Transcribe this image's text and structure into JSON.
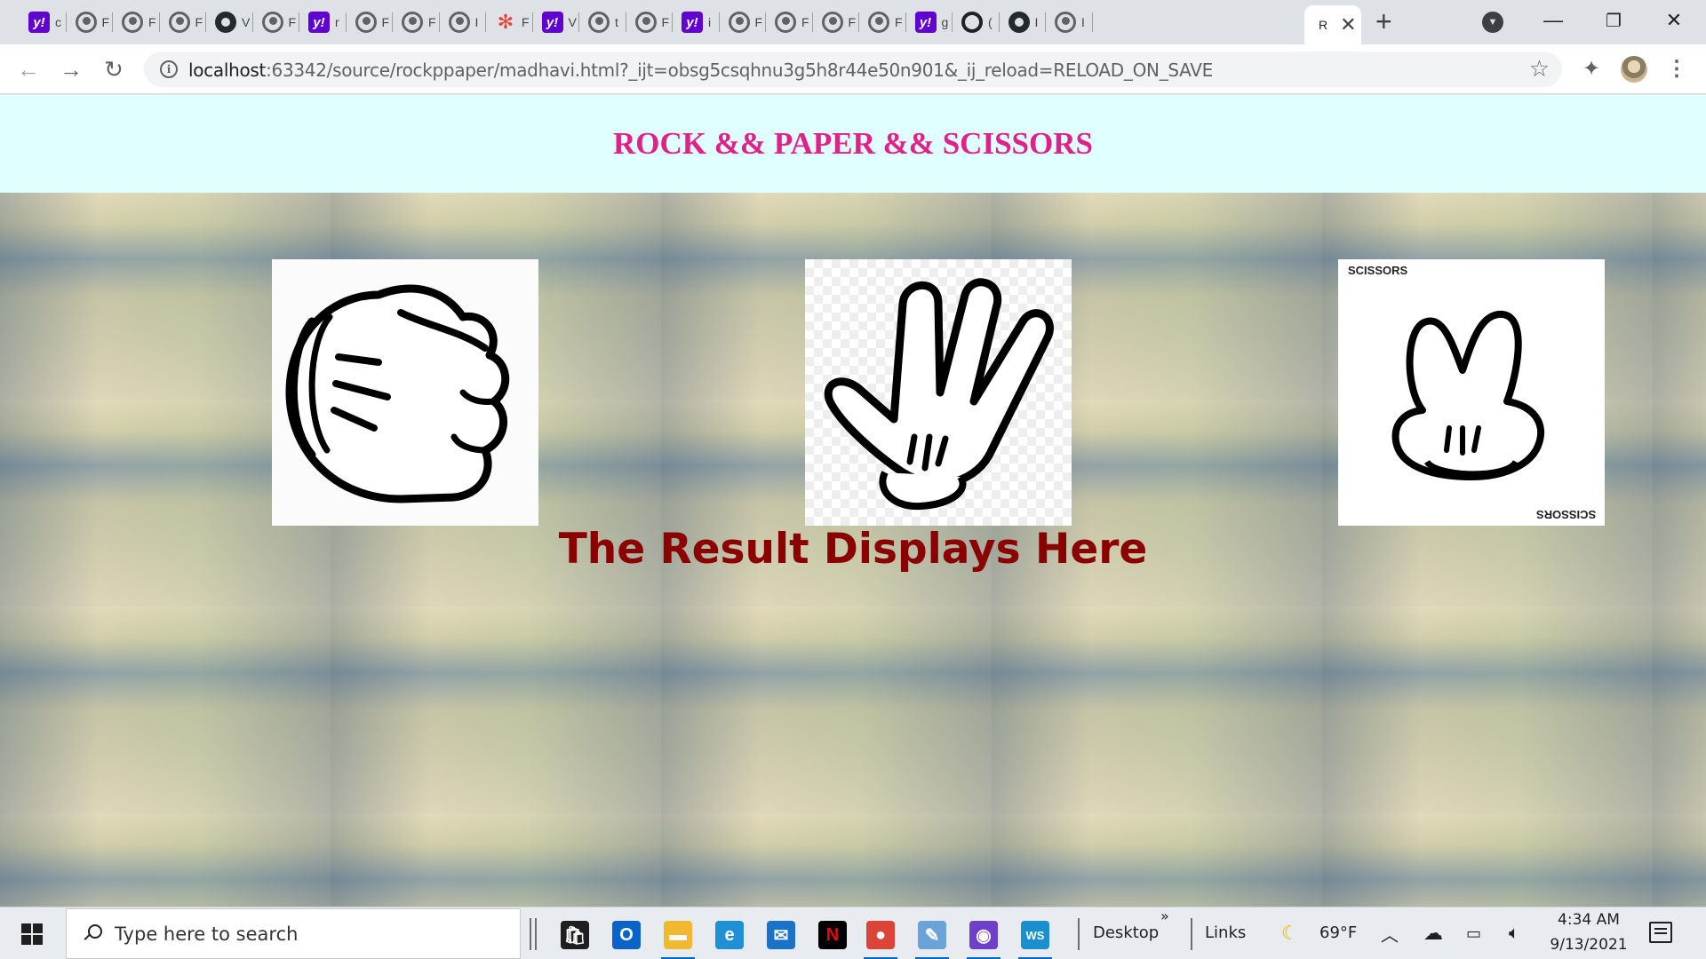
{
  "browser": {
    "tabs": [
      {
        "icon": "yahoo-icon",
        "label": "c"
      },
      {
        "icon": "globe-icon",
        "label": "F"
      },
      {
        "icon": "globe-icon",
        "label": "F"
      },
      {
        "icon": "globe-icon",
        "label": "F"
      },
      {
        "icon": "github-icon",
        "label": "V"
      },
      {
        "icon": "globe-icon",
        "label": "F"
      },
      {
        "icon": "yahoo-icon",
        "label": "r"
      },
      {
        "icon": "globe-icon",
        "label": "F"
      },
      {
        "icon": "globe-icon",
        "label": "F"
      },
      {
        "icon": "globe-icon",
        "label": "I"
      },
      {
        "icon": "pinwheel-icon",
        "label": "F"
      },
      {
        "icon": "yahoo-icon",
        "label": "V"
      },
      {
        "icon": "globe-icon",
        "label": "t"
      },
      {
        "icon": "globe-icon",
        "label": "F"
      },
      {
        "icon": "yahoo-icon",
        "label": "i"
      },
      {
        "icon": "globe-icon",
        "label": "F"
      },
      {
        "icon": "globe-icon",
        "label": "F"
      },
      {
        "icon": "globe-icon",
        "label": "F"
      },
      {
        "icon": "globe-icon",
        "label": "F"
      },
      {
        "icon": "yahoo-icon",
        "label": "g"
      },
      {
        "icon": "ring-icon",
        "label": "("
      },
      {
        "icon": "github-icon",
        "label": "I"
      },
      {
        "icon": "globe-icon",
        "label": "I"
      }
    ],
    "active_tab": {
      "label": "R",
      "close": "✕"
    },
    "new_tab_label": "+",
    "yahoo_glyph": "y!",
    "url_host": "localhost",
    "url_rest": ":63342/source/rockppaper/madhavi.html?_ijt=obsg5csqhnu3g5h8r44e50n901&_ij_reload=RELOAD_ON_SAVE",
    "window_controls": {
      "minimize": "—",
      "restore": "❐",
      "close": "✕"
    },
    "nav": {
      "back": "←",
      "forward": "→",
      "reload": "↻"
    }
  },
  "page": {
    "title": "ROCK && PAPER && SCISSORS",
    "choices": [
      {
        "name": "rock"
      },
      {
        "name": "paper"
      },
      {
        "name": "scissors",
        "image_label": "SCISSORS"
      }
    ],
    "result_text": "The Result Displays Here",
    "colors": {
      "header_bg": "#e0ffff",
      "title": "#e0218a",
      "result": "#8b0000"
    }
  },
  "taskbar": {
    "search_placeholder": "Type here to search",
    "desktop_label": "Desktop",
    "links_label": "Links",
    "overflow": "»",
    "weather": "69°F",
    "time": "4:34 AM",
    "date": "9/13/2021",
    "apps": [
      {
        "name": "store",
        "color": "#1f1f1f"
      },
      {
        "name": "outlook",
        "color": "#0a64c8"
      },
      {
        "name": "file-explorer",
        "color": "#f2b930"
      },
      {
        "name": "edge",
        "color": "#1f8fd6"
      },
      {
        "name": "mail",
        "color": "#1a73c8"
      },
      {
        "name": "netflix",
        "color": "#000000"
      },
      {
        "name": "chrome",
        "color": "#db4437"
      },
      {
        "name": "paint",
        "color": "#6aa3d8"
      },
      {
        "name": "github-desktop",
        "color": "#6e40c9"
      },
      {
        "name": "webstorm",
        "color": "#1a8fd0"
      }
    ]
  }
}
